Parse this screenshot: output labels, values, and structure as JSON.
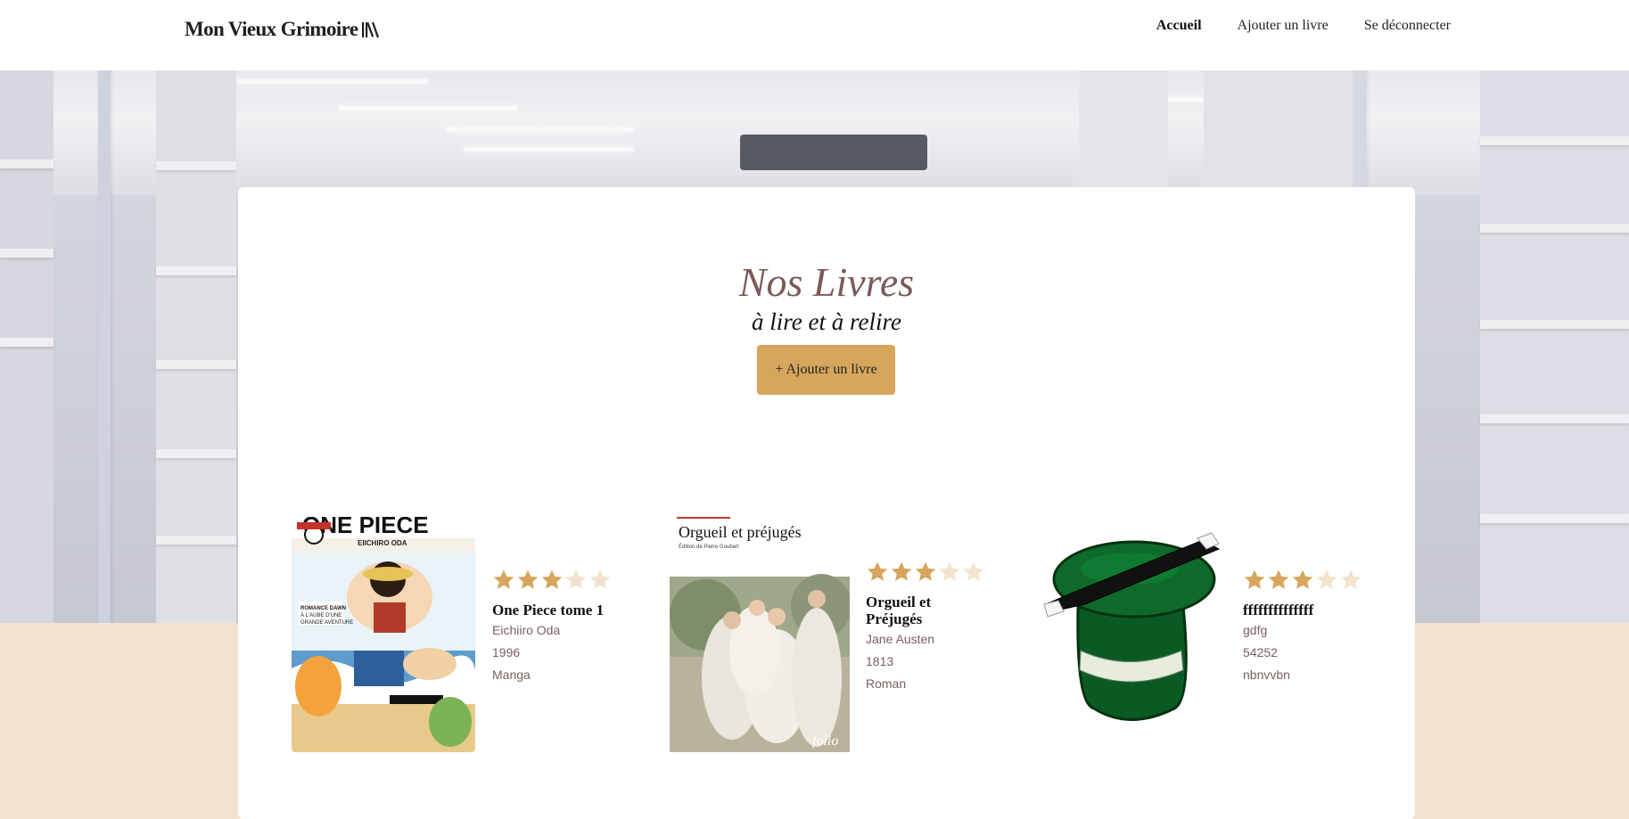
{
  "header": {
    "logo_text": "Mon Vieux Grimoire",
    "logo_icon": "books-icon",
    "nav": [
      {
        "label": "Accueil",
        "active": true
      },
      {
        "label": "Ajouter un livre",
        "active": false
      },
      {
        "label": "Se déconnecter",
        "active": false
      }
    ]
  },
  "main": {
    "title": "Nos Livres",
    "subtitle": "à lire et à relire",
    "add_button_label": "+ Ajouter un livre"
  },
  "books": [
    {
      "cover_title": "ONE PIECE",
      "cover_author": "EIICHIRO ODA",
      "cover_tagline": "ROMANCE DAWN À L'AUBE D'UNE GRANDE AVENTURE",
      "rating": 3,
      "rating_max": 5,
      "title": "One Piece tome 1",
      "author": "Eichiiro Oda",
      "year": "1996",
      "genre": "Manga"
    },
    {
      "cover_title": "Orgueil et préjugés",
      "cover_caption": "Édition de Pierre Goubert",
      "cover_brand": "folio",
      "rating": 3,
      "rating_max": 5,
      "title": "Orgueil et Préjugés",
      "author": "Jane Austen",
      "year": "1813",
      "genre": "Roman"
    },
    {
      "rating": 3,
      "rating_max": 5,
      "title": "ffffffffffffff",
      "author": "gdfg",
      "year": "54252",
      "genre": "nbnvvbn"
    }
  ],
  "colors": {
    "accent": "#d6a65c",
    "star_filled": "#d6a65c",
    "star_empty": "#f2e4cd",
    "title": "#7a5a58",
    "footer_band": "#f1e3cf"
  }
}
